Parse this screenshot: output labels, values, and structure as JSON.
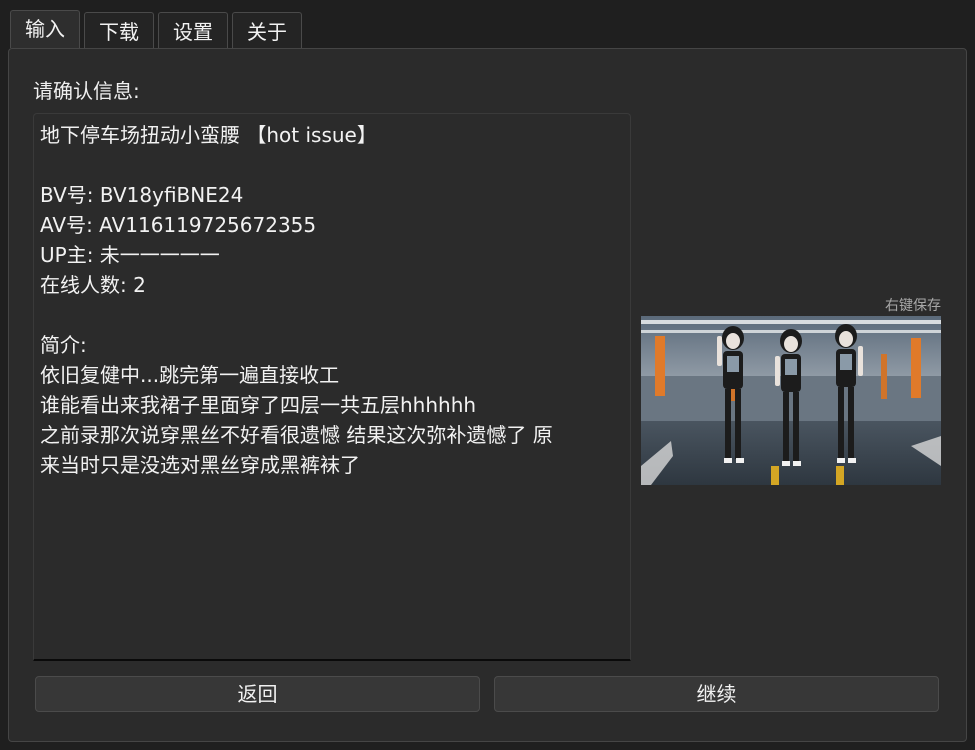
{
  "tabs": [
    {
      "label": "输入",
      "active": true
    },
    {
      "label": "下载",
      "active": false
    },
    {
      "label": "设置",
      "active": false
    },
    {
      "label": "关于",
      "active": false
    }
  ],
  "prompt": "请确认信息:",
  "info": {
    "title": "地下停车场扭动小蛮腰 【hot issue】",
    "bv": "BV号: BV18yfiBNE24",
    "av": "AV号: AV116119725672355",
    "up": "UP主: 未一一一一一",
    "online": "在线人数: 2",
    "intro_label": "简介:",
    "intro_lines": [
      "依旧复健中...跳完第一遍直接收工",
      "谁能看出来我裙子里面穿了四层一共五层hhhhhh",
      "之前录那次说穿黑丝不好看很遗憾 结果这次弥补遗憾了 原",
      "来当时只是没选对黑丝穿成黑裤袜了"
    ]
  },
  "thumbnail_hint": "右键保存",
  "buttons": {
    "back": "返回",
    "continue": "继续"
  }
}
